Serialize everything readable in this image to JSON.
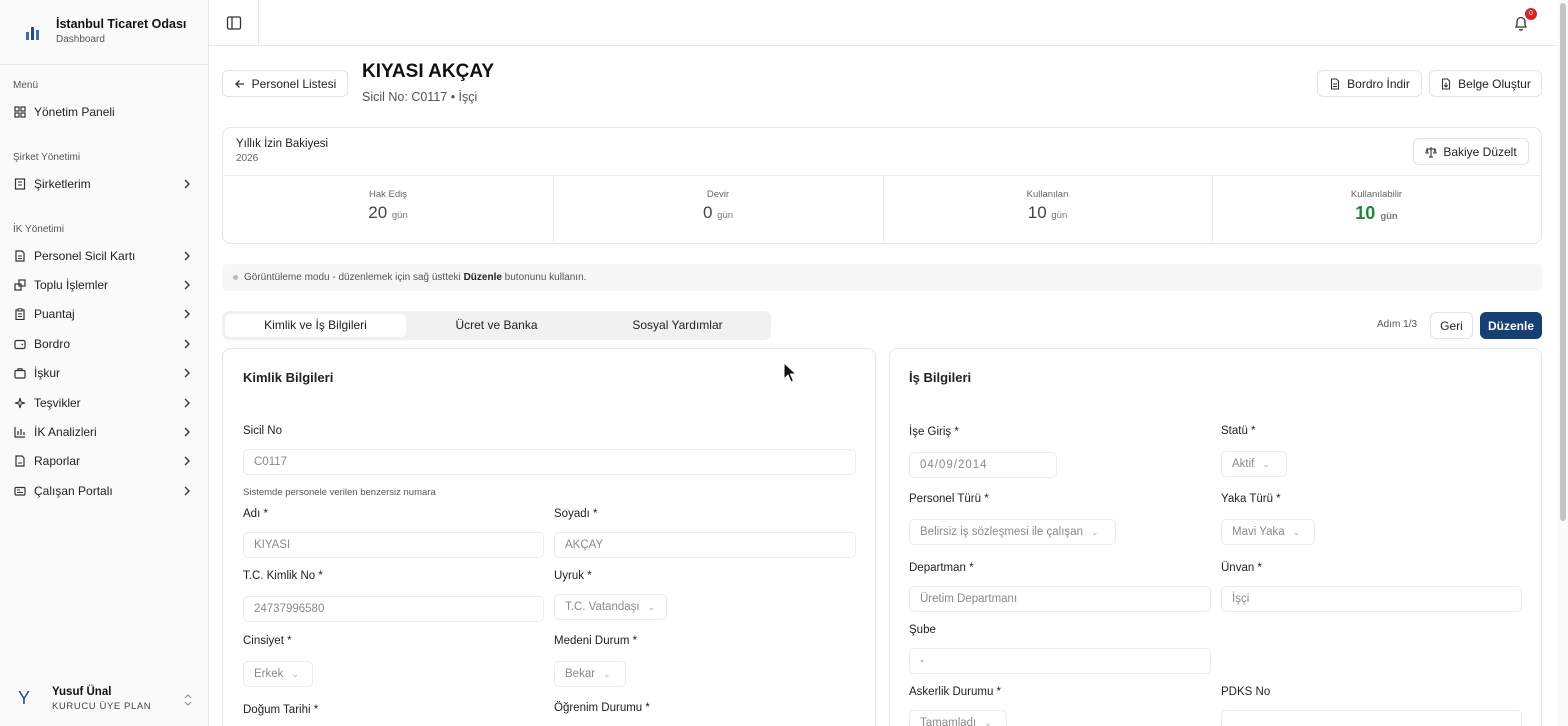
{
  "sidebar": {
    "brand_title": "İstanbul Ticaret Odası",
    "brand_sub": "Dashboard",
    "sections": [
      {
        "label": "Menü"
      },
      {
        "label": "Şirket Yönetimi"
      },
      {
        "label": "İK Yönetimi"
      }
    ],
    "items": [
      {
        "label": "Yönetim Paneli",
        "icon": "dashboard-icon"
      },
      {
        "label": "Şirketlerim",
        "icon": "building-icon"
      },
      {
        "label": "Personel Sicil Kartı",
        "icon": "document-icon"
      },
      {
        "label": "Toplu İşlemler",
        "icon": "layers-icon"
      },
      {
        "label": "Puantaj",
        "icon": "clipboard-icon"
      },
      {
        "label": "Bordro",
        "icon": "wallet-icon"
      },
      {
        "label": "İşkur",
        "icon": "briefcase-icon"
      },
      {
        "label": "Teşvikler",
        "icon": "sparkle-icon"
      },
      {
        "label": "İK Analizleri",
        "icon": "bar-chart-icon"
      },
      {
        "label": "Raporlar",
        "icon": "report-icon"
      },
      {
        "label": "Çalışan Portalı",
        "icon": "id-card-icon"
      }
    ],
    "user": {
      "initial": "Y",
      "name": "Yusuf Ünal",
      "plan": "KURUCU ÜYE PLAN"
    }
  },
  "topbar": {
    "notification_count": "0"
  },
  "header": {
    "back_label": "Personel Listesi",
    "title": "KIYASI AKÇAY",
    "subtitle": "Sicil No: C0117 • İşçi",
    "bordro_label": "Bordro İndir",
    "belge_label": "Belge Oluştur"
  },
  "leave": {
    "title": "Yıllık İzin Bakiyesi",
    "year": "2026",
    "adjust_label": "Bakiye Düzelt",
    "unit": "gün",
    "stats": [
      {
        "label": "Hak Ediş",
        "value": "20"
      },
      {
        "label": "Devir",
        "value": "0"
      },
      {
        "label": "Kullanılan",
        "value": "10"
      },
      {
        "label": "Kullanılabilir",
        "value": "10"
      }
    ]
  },
  "info": {
    "before": "Görüntüleme modu - düzenlemek için sağ üstteki ",
    "bold": "Düzenle",
    "after": " butonunu kullanın."
  },
  "tabs": [
    "Kimlik ve İş Bilgileri",
    "Ücret ve Banka",
    "Sosyal Yardımlar"
  ],
  "step": {
    "label": "Adım 1/3",
    "back": "Geri",
    "edit": "Düzenle"
  },
  "identity": {
    "title": "Kimlik Bilgileri",
    "sicil_label": "Sicil No",
    "sicil_value": "C0117",
    "sicil_hint": "Sistemde personele verilen benzersiz numara",
    "ad_label": "Adı *",
    "ad_value": "KIYASI",
    "soyad_label": "Soyadı *",
    "soyad_value": "AKÇAY",
    "tc_label": "T.C. Kimlik No *",
    "tc_value": "24737996580",
    "uyruk_label": "Uyruk *",
    "uyruk_value": "T.C. Vatandaşı",
    "cinsiyet_label": "Cinsiyet *",
    "cinsiyet_value": "Erkek",
    "medeni_label": "Medeni Durum *",
    "medeni_value": "Bekar",
    "dogum_label": "Doğum Tarihi *",
    "ogrenim_label": "Öğrenim Durumu *"
  },
  "job": {
    "title": "İş Bilgileri",
    "giris_label": "İşe Giriş *",
    "giris_value": "04/09/2014",
    "statu_label": "Statü *",
    "statu_value": "Aktif",
    "tur_label": "Personel Türü *",
    "tur_value": "Belirsiz iş sözleşmesi ile çalışan",
    "yaka_label": "Yaka Türü *",
    "yaka_value": "Mavi Yaka",
    "dept_label": "Departman *",
    "dept_value": "Üretim Departmanı",
    "unvan_label": "Ünvan *",
    "unvan_value": "İşçi",
    "sube_label": "Şube",
    "sube_value": "-",
    "asker_label": "Askerlik Durumu *",
    "asker_value": "Tamamladı",
    "pdks_label": "PDKS No"
  }
}
